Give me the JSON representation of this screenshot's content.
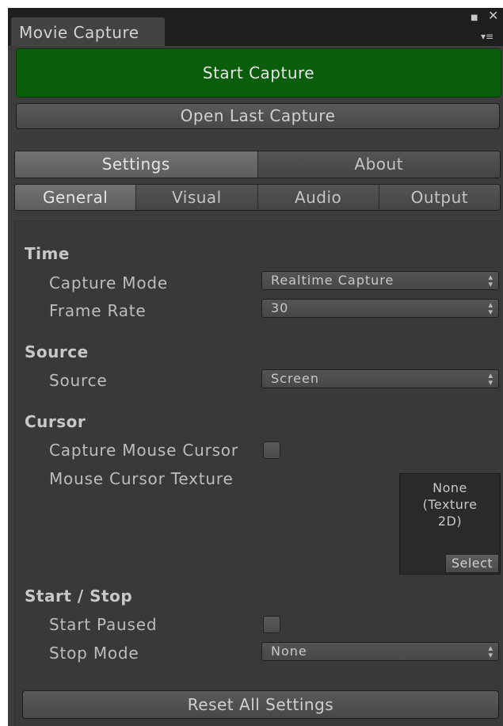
{
  "window": {
    "tab_title": "Movie Capture",
    "icons": [
      "maximize-icon",
      "close-icon",
      "menu-icon"
    ]
  },
  "actions": {
    "start_capture": "Start Capture",
    "open_last_capture": "Open Last Capture",
    "reset_all": "Reset All Settings"
  },
  "main_tabs": [
    {
      "label": "Settings",
      "active": true
    },
    {
      "label": "About",
      "active": false
    }
  ],
  "sub_tabs": [
    {
      "label": "General",
      "active": true
    },
    {
      "label": "Visual",
      "active": false
    },
    {
      "label": "Audio",
      "active": false
    },
    {
      "label": "Output",
      "active": false
    }
  ],
  "sections": {
    "time": {
      "heading": "Time",
      "capture_mode": {
        "label": "Capture Mode",
        "value": "Realtime Capture"
      },
      "frame_rate": {
        "label": "Frame Rate",
        "value": "30"
      }
    },
    "source": {
      "heading": "Source",
      "source": {
        "label": "Source",
        "value": "Screen"
      }
    },
    "cursor": {
      "heading": "Cursor",
      "capture_mouse": {
        "label": "Capture Mouse Cursor",
        "checked": false
      },
      "cursor_texture": {
        "label": "Mouse Cursor Texture",
        "value_line1": "None",
        "value_line2": "(Texture",
        "value_line3": "2D)",
        "select_label": "Select"
      }
    },
    "start_stop": {
      "heading": "Start / Stop",
      "start_paused": {
        "label": "Start Paused",
        "checked": false
      },
      "stop_mode": {
        "label": "Stop Mode",
        "value": "None"
      }
    }
  },
  "colors": {
    "accent_green": "#0a5d0a",
    "panel_bg": "#3c3c3c",
    "tabstrip_bg": "#1e1e1e"
  }
}
